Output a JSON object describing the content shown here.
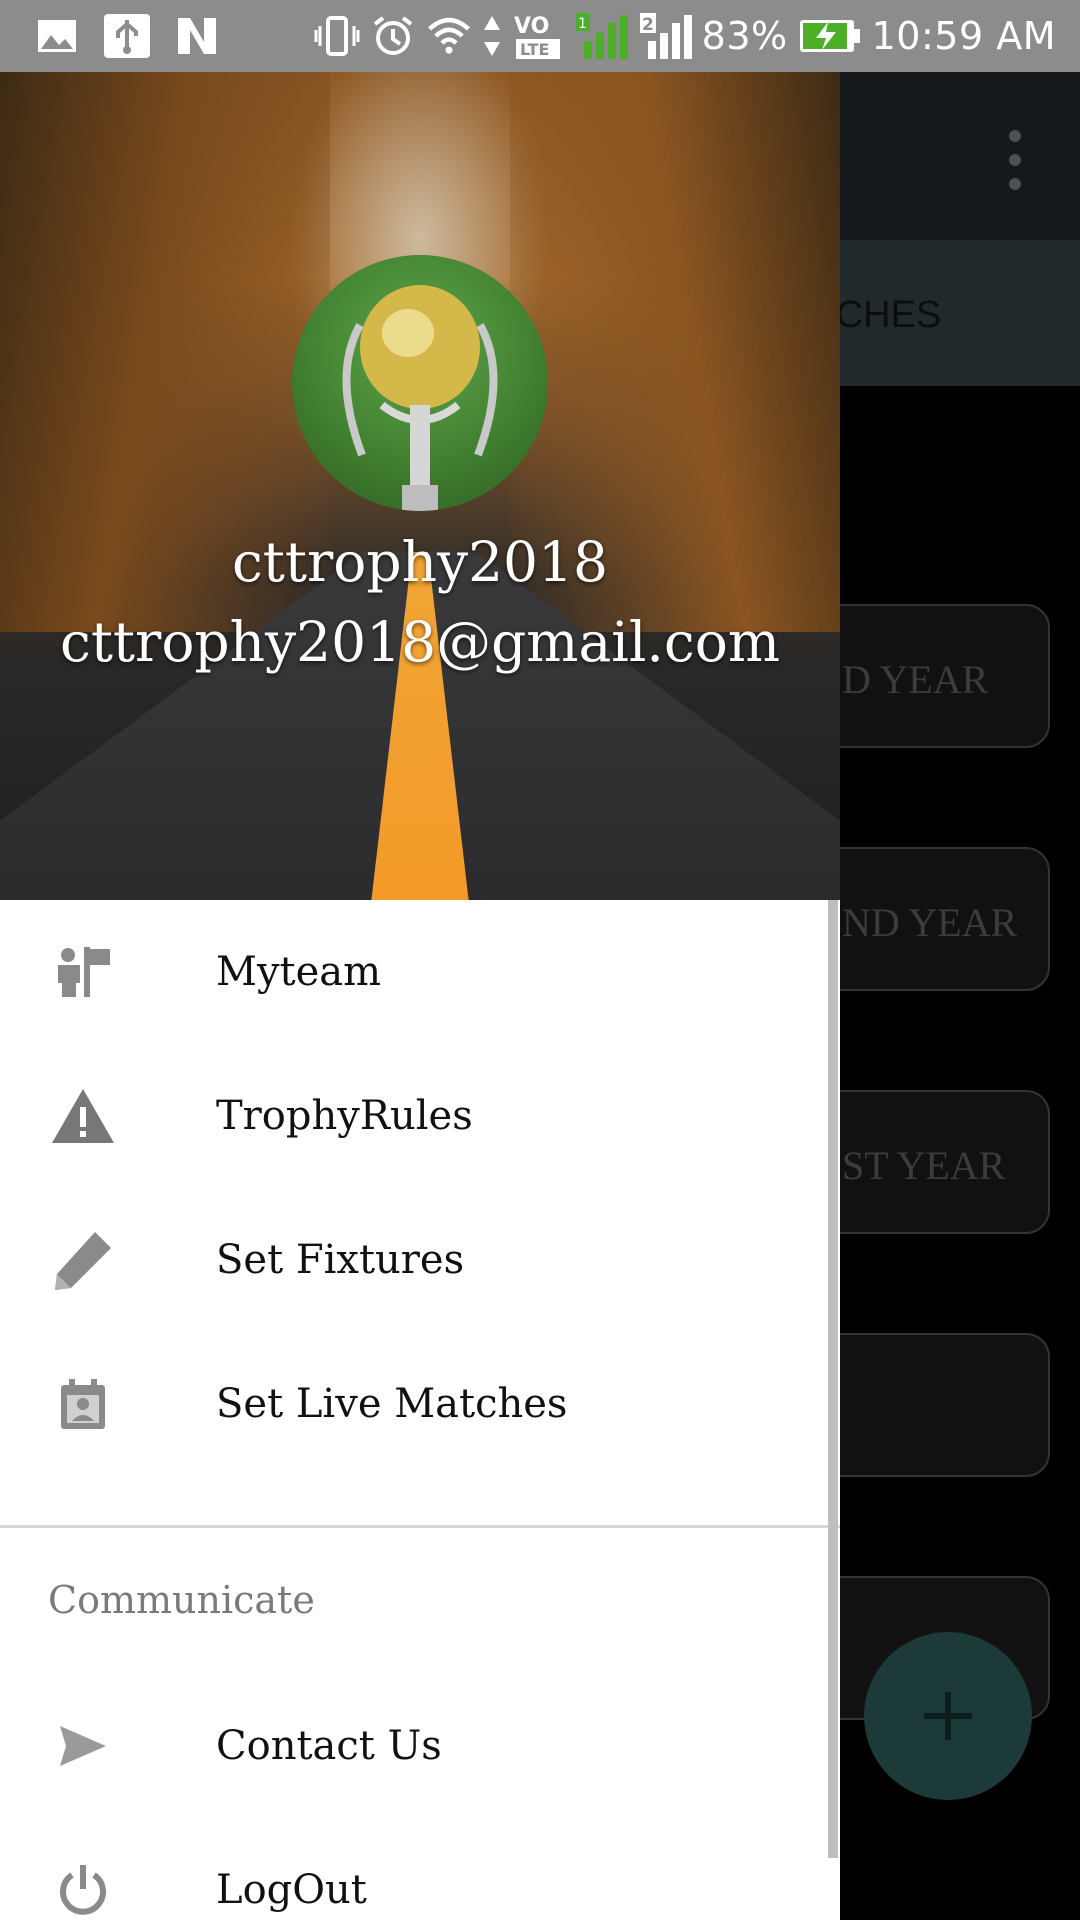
{
  "status_bar": {
    "battery": "83%",
    "time": "10:59 AM",
    "icons": [
      "image-icon",
      "usb-icon",
      "n-icon",
      "vibrate-icon",
      "alarm-icon",
      "wifi-icon",
      "volte-icon",
      "signal-1-icon",
      "signal-2-icon",
      "battery-charging-icon"
    ]
  },
  "background": {
    "tab_label": "ATCHES",
    "cards": [
      "D YEAR",
      "ND YEAR",
      "ST YEAR",
      "",
      ""
    ],
    "fab_symbol": "+"
  },
  "drawer": {
    "header": {
      "name": "cttrophy2018",
      "email": "cttrophy2018@gmail.com"
    },
    "items": [
      {
        "label": "Myteam",
        "icon": "team-icon"
      },
      {
        "label": "TrophyRules",
        "icon": "warning-icon"
      },
      {
        "label": "Set Fixtures",
        "icon": "pencil-icon"
      },
      {
        "label": "Set Live Matches",
        "icon": "calendar-person-icon"
      }
    ],
    "section_title": "Communicate",
    "communicate_items": [
      {
        "label": "Contact Us",
        "icon": "send-icon"
      },
      {
        "label": "LogOut",
        "icon": "power-icon"
      }
    ]
  },
  "colors": {
    "status_bar": "#8c8c8c",
    "icon_gray": "#8a8a8a",
    "fab": "#1b3a38"
  }
}
